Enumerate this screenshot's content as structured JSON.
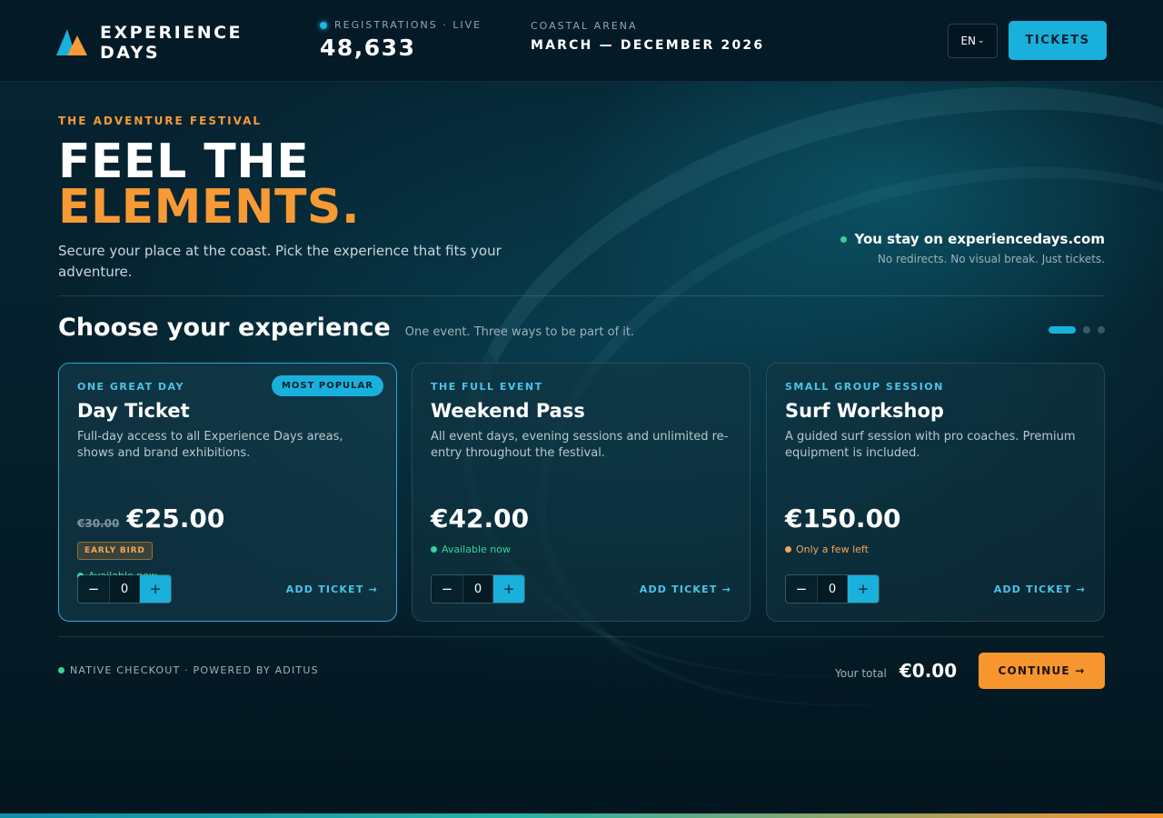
{
  "header": {
    "logo_line1": "EXPERIENCE",
    "logo_line2": "DAYS",
    "registrations_label": "REGISTRATIONS · LIVE",
    "registrations_count": "48,633",
    "venue_label": "COASTAL ARENA",
    "venue_dates": "MARCH — DECEMBER 2026",
    "language": "EN",
    "tickets_label": "TICKETS"
  },
  "hero": {
    "eyebrow": "THE ADVENTURE FESTIVAL",
    "title_line1": "FEEL THE",
    "title_line2": "ELEMENTS.",
    "subtitle": "Secure your place at the coast. Pick the experience that fits your adventure.",
    "stay_title": "You stay on experiencedays.com",
    "stay_sub": "No redirects. No visual break. Just tickets."
  },
  "section": {
    "title": "Choose your experience",
    "subtitle": "One event. Three ways to be part of it."
  },
  "cards": [
    {
      "eyebrow": "ONE GREAT DAY",
      "title": "Day Ticket",
      "description": "Full-day access to all Experience Days areas, shows and brand exhibitions.",
      "badge": "MOST POPULAR",
      "old_price": "€30.00",
      "price": "€25.00",
      "tag": "EARLY BIRD",
      "availability": "Available now",
      "quantity": "0",
      "add_label": "ADD TICKET →"
    },
    {
      "eyebrow": "THE FULL EVENT",
      "title": "Weekend Pass",
      "description": "All event days, evening sessions and unlimited re-entry throughout the festival.",
      "price": "€42.00",
      "availability": "Available now",
      "quantity": "0",
      "add_label": "ADD TICKET →"
    },
    {
      "eyebrow": "SMALL GROUP SESSION",
      "title": "Surf Workshop",
      "description": "A guided surf session with pro coaches. Premium equipment is included.",
      "price": "€150.00",
      "availability": "Only a few left",
      "quantity": "0",
      "add_label": "ADD TICKET →"
    }
  ],
  "footer": {
    "note": "NATIVE CHECKOUT · POWERED BY ADITUS",
    "total_label": "Your total",
    "total_value": "€0.00",
    "continue_label": "CONTINUE →"
  },
  "colors": {
    "accent_blue": "#1ab0dc",
    "accent_orange": "#f79a35",
    "available_green": "#34d399",
    "background": "#031722"
  },
  "icons": {
    "logo": "mountain-logo-icon",
    "live": "live-dot-icon",
    "language_caret": "chevron-down-icon",
    "minus": "minus-icon",
    "plus": "plus-icon"
  }
}
